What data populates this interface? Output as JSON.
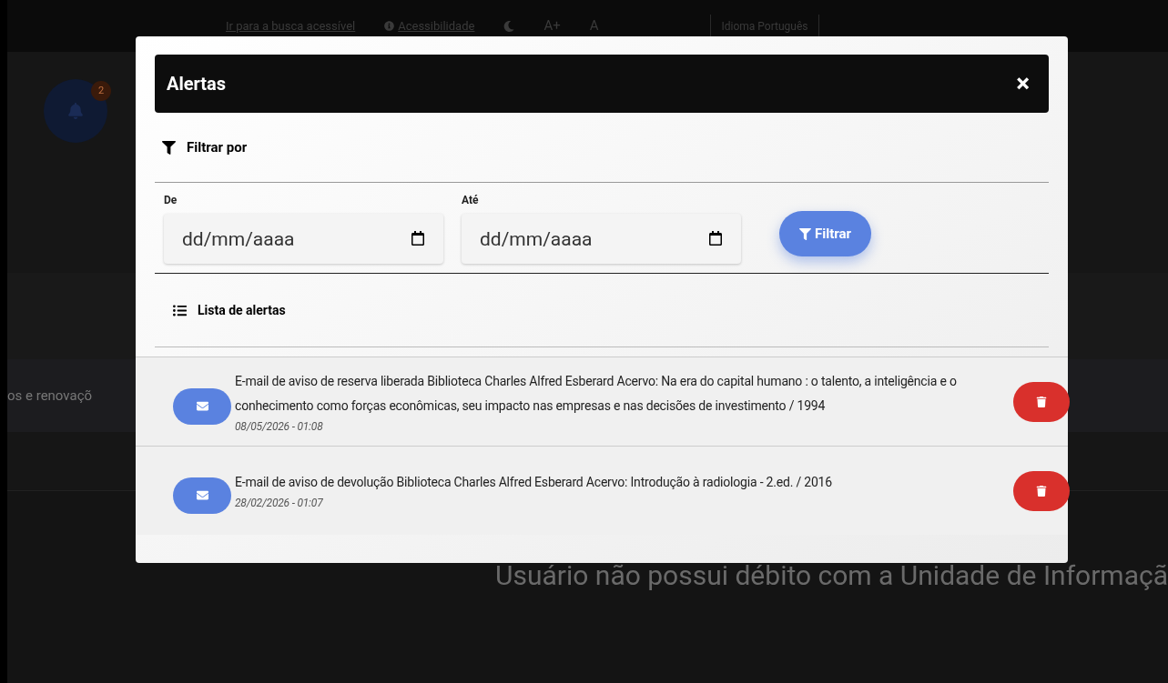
{
  "background": {
    "top_bar": {
      "links": [
        "Ir para a busca acessível",
        "Acessibilidade"
      ],
      "font_buttons": [
        "A+",
        "A"
      ],
      "language": "Idioma Português"
    },
    "notification_count": "2",
    "tab_text": "os e renovaçõ",
    "debt_message": "Usuário não possui débito com a Unidade de Informaçã"
  },
  "modal": {
    "title": "Alertas",
    "close": "×",
    "filter": {
      "heading": "Filtrar por",
      "fields": [
        {
          "label": "De",
          "placeholder": "dd/mm/aaaa"
        },
        {
          "label": "Até",
          "placeholder": "dd/mm/aaaa"
        }
      ],
      "button": "Filtrar"
    },
    "list_heading": "Lista de alertas",
    "alerts": [
      {
        "text": "E-mail de aviso de reserva liberada Biblioteca Charles Alfred Esberard Acervo: Na era do capital humano : o talento, a inteligência e o conhecimento como forças econômicas, seu impacto nas empresas e nas decisões de investimento / 1994",
        "date": "08/05/2026 - 01:08"
      },
      {
        "text": "E-mail de aviso de devolução Biblioteca Charles Alfred Esberard Acervo: Introdução à radiologia - 2.ed. / 2016",
        "date": "28/02/2026 - 01:07"
      }
    ]
  }
}
